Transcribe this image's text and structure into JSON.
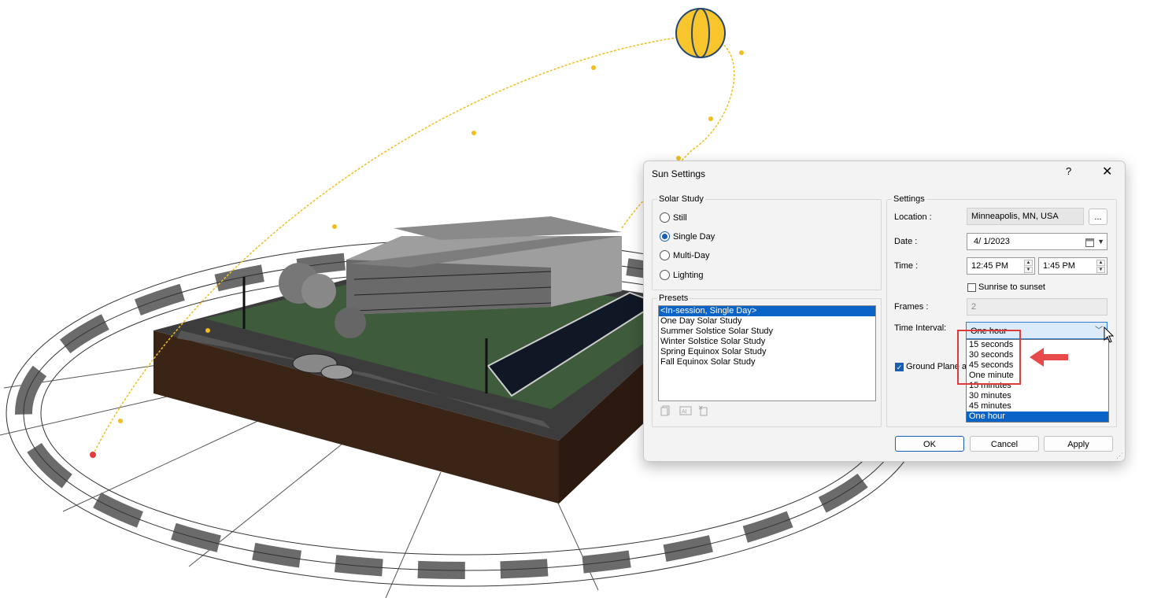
{
  "dialog": {
    "title": "Sun Settings",
    "help_label": "?",
    "close_label": "✕",
    "solar_study": {
      "group_label": "Solar Study",
      "options": [
        {
          "label": "Still",
          "selected": false
        },
        {
          "label": "Single Day",
          "selected": true
        },
        {
          "label": "Multi-Day",
          "selected": false
        },
        {
          "label": "Lighting",
          "selected": false
        }
      ]
    },
    "presets": {
      "group_label": "Presets",
      "items": [
        "<In-session, Single Day>",
        "One Day Solar Study",
        "Summer Solstice Solar Study",
        "Winter Solstice Solar Study",
        "Spring Equinox Solar Study",
        "Fall Equinox Solar Study"
      ],
      "selected_index": 0,
      "icons": [
        "duplicate-preset-icon",
        "rename-preset-icon",
        "delete-preset-icon"
      ]
    },
    "settings": {
      "group_label": "Settings",
      "location_label": "Location :",
      "location_value": "Minneapolis, MN, USA",
      "location_browse_label": "...",
      "date_label": "Date :",
      "date_value": "4/  1/2023",
      "time_label": "Time :",
      "time_start": "12:45 PM",
      "time_end": "1:45 PM",
      "sunrise_to_sunset_label": "Sunrise to sunset",
      "sunrise_to_sunset_checked": false,
      "frames_label": "Frames :",
      "frames_value": "2",
      "time_interval_label": "Time Interval:",
      "time_interval_value": "One hour",
      "time_interval_options": [
        "15 seconds",
        "30 seconds",
        "45 seconds",
        "One minute",
        "15 minutes",
        "30 minutes",
        "45 minutes",
        "One hour"
      ],
      "time_interval_selected_index": 7,
      "ground_plane_label": "Ground Plane a",
      "ground_plane_checked": true
    },
    "buttons": {
      "ok": "OK",
      "cancel": "Cancel",
      "apply": "Apply"
    }
  },
  "colors": {
    "accent": "#0a64c8",
    "highlight_box": "#e03a3a",
    "sun": "#f9c52c",
    "sun_path": "#f2bd1f"
  }
}
